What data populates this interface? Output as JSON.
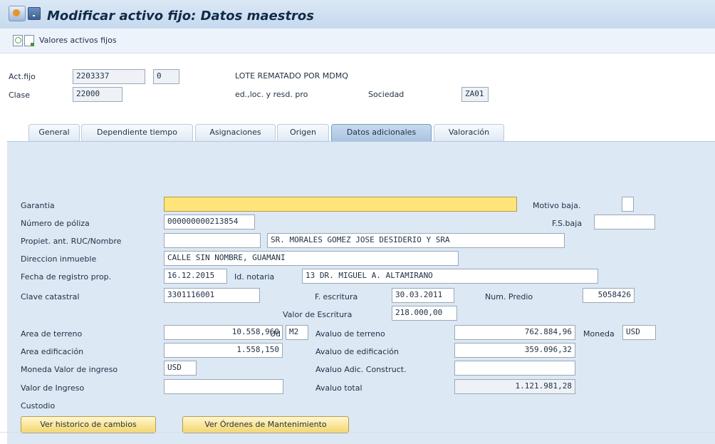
{
  "window": {
    "title": "Modificar activo fijo: Datos maestros",
    "icons": [
      "sap-logo-icon",
      "menu-icon"
    ]
  },
  "toolbar": {
    "icons": [
      "new-document-icon",
      "copy-document-icon"
    ],
    "label": "Valores activos fijos"
  },
  "header": {
    "actfijo_label": "Act.fijo",
    "actfijo_value": "2203337",
    "sub_value": "0",
    "description": "LOTE REMATADO POR MDMQ",
    "clase_label": "Clase",
    "clase_value": "22000",
    "clase_description": "ed.,loc. y resd. pro",
    "sociedad_label": "Sociedad",
    "sociedad_value": "ZA01"
  },
  "tabs": [
    {
      "label": "General"
    },
    {
      "label": "Dependiente tiempo"
    },
    {
      "label": "Asignaciones"
    },
    {
      "label": "Origen"
    },
    {
      "label": "Datos adicionales",
      "active": true
    },
    {
      "label": "Valoración"
    }
  ],
  "form": {
    "garantia": {
      "label": "Garantia",
      "value": ""
    },
    "motivo_baja": {
      "label": "Motivo baja.",
      "value": ""
    },
    "numero_poliza": {
      "label": "Número de póliza",
      "value": "000000000213854"
    },
    "fs_baja": {
      "label": "F.S.baja",
      "value": ""
    },
    "propiet": {
      "label": "Propiet. ant. RUC/Nombre",
      "ruc_value": "",
      "name_value": "SR. MORALES GOMEZ JOSE DESIDERIO Y SRA"
    },
    "direccion": {
      "label": "Direccion inmueble",
      "value": "CALLE SIN NOMBRE, GUAMANI"
    },
    "fecha_registro": {
      "label": "Fecha de registro prop.",
      "value": "16.12.2015"
    },
    "id_notaria": {
      "label": "Id. notaria",
      "value": "13 DR. MIGUEL A. ALTAMIRANO"
    },
    "clave_catastral": {
      "label": "Clave catastral",
      "value": "3301116001"
    },
    "f_escritura": {
      "label": "F. escritura",
      "value": "30.03.2011"
    },
    "num_predio": {
      "label": "Num. Predio",
      "value": "5058426"
    },
    "valor_escritura": {
      "label": "Valor de Escritura",
      "value": "218.000,00"
    },
    "area_terreno": {
      "label": "Area de terreno",
      "value": "10.558,960",
      "ud_label": "Ud",
      "ud_value": "M2"
    },
    "avaluo_terreno": {
      "label": "Avaluo de terreno",
      "value": "762.884,96"
    },
    "moneda": {
      "label": "Moneda",
      "value": "USD"
    },
    "area_edificacion": {
      "label": "Area edificación",
      "value": "1.558,150"
    },
    "avaluo_edificacion": {
      "label": "Avaluo de edificación",
      "value": "359.096,32"
    },
    "moneda_valor_ingreso": {
      "label": "Moneda Valor de ingreso",
      "value": "USD"
    },
    "avaluo_adic": {
      "label": "Avaluo Adic. Construct.",
      "value": ""
    },
    "valor_ingreso": {
      "label": "Valor de Ingreso",
      "value": ""
    },
    "avaluo_total": {
      "label": "Avaluo total",
      "value": "1.121.981,28"
    },
    "custodio": {
      "label": "Custodio"
    }
  },
  "buttons": {
    "historico": "Ver historico de cambios",
    "ordenes": "Ver Órdenes de Mantenimiento"
  },
  "colors": {
    "accent_yellow": "#ffe47a",
    "panel_blue": "#dce8f4",
    "title_bar": "#c6d9ee"
  }
}
